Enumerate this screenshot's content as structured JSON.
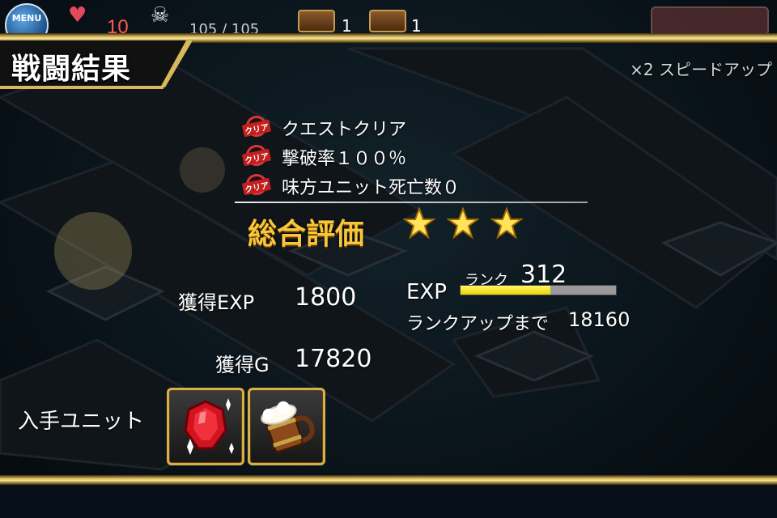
{
  "hud": {
    "menu_label": "MENU",
    "lives_icon": "heart-icon",
    "lives": "10",
    "kills_icon": "skull-icon",
    "kills_text": "105 / 105",
    "chest_counts": [
      "1",
      "1"
    ]
  },
  "result": {
    "title": "戦闘結果",
    "speed_label": "×2  スピードアップ",
    "missions": [
      {
        "badge": "クリア",
        "text": "クエストクリア"
      },
      {
        "badge": "クリア",
        "text": "撃破率１００％"
      },
      {
        "badge": "クリア",
        "text": "味方ユニット死亡数０"
      }
    ],
    "rating_label": "総合評価",
    "stars": 3,
    "exp_gain_label": "獲得EXP",
    "exp_gain_value": "1800",
    "gold_gain_label": "獲得G",
    "gold_gain_value": "17820",
    "exp_title": "EXP",
    "rank_label": "ランク",
    "rank_value": "312",
    "exp_progress": 0.58,
    "rankup_label": "ランクアップまで",
    "rankup_value": "18160",
    "units_label": "入手ユニット",
    "units": [
      {
        "icon": "ruby-gem-icon"
      },
      {
        "icon": "beer-mug-icon"
      }
    ]
  },
  "colors": {
    "gold": "#f7c63b",
    "frame": "#d8b85a",
    "exp_fill": "#fff86a",
    "clear_red": "#c21f1f"
  }
}
